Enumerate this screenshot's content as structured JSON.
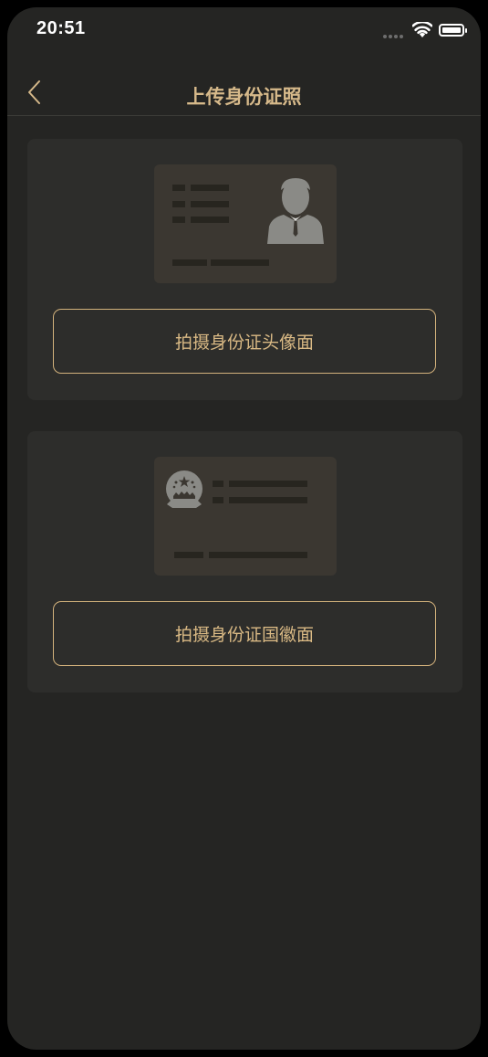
{
  "status_bar": {
    "time": "20:51",
    "icons": [
      "signal-dots-icon",
      "wifi-icon",
      "battery-icon"
    ]
  },
  "navbar": {
    "back_icon": "chevron-left-icon",
    "title": "上传身份证照"
  },
  "cards": [
    {
      "illustration": "id-card-portrait-side-icon",
      "button_label": "拍摄身份证头像面"
    },
    {
      "illustration": "id-card-emblem-side-icon",
      "button_label": "拍摄身份证国徽面"
    }
  ],
  "colors": {
    "background": "#252523",
    "card": "#2d2d2b",
    "accent": "#d6b98a",
    "illustration_fill": "#3b3731",
    "illustration_icon": "#8a8a86"
  }
}
